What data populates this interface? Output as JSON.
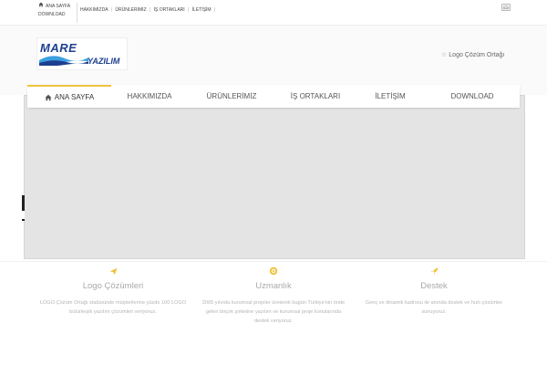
{
  "topbar": {
    "left_links": [
      "ANA SAYFA",
      "DOWNLOAD"
    ],
    "menu": [
      "HAKKIMIZDA",
      "ÜRÜNLERIMIZ",
      "İŞ ORTAKLARI",
      "İLETİŞİM"
    ],
    "menu_sep": "|"
  },
  "header": {
    "logo_top": "MARE",
    "logo_bottom": "YAZILIM",
    "partner_text": "Logo Çözüm Ortağı"
  },
  "nav": {
    "items": [
      "ANA SAYFA",
      "HAKKIMIZDA",
      "ÜRÜNLERİMİZ",
      "İŞ ORTAKLARI",
      "İLETİŞİM",
      "DOWNLOAD"
    ]
  },
  "features": [
    {
      "icon": "send-icon",
      "title": "Logo Çözümleri",
      "text": "LOGO Çözüm Ortağı statüsünde müşterilerine yüzde 100 LOGO bütünleşik yazılım çözümleri veriyoruz."
    },
    {
      "icon": "badge-icon",
      "title": "Uzmanlık",
      "text": "2005 yılında kurumsal projeler üreterek bugün Türkiye'nin önde gelen birçok şirketine yazılım ve kurumsal proje konularında destek veriyoruz."
    },
    {
      "icon": "rocket-icon",
      "title": "Destek",
      "text": "Genç ve dinamik kadrosu ile anında destek ve hızlı çözümler sunuyoruz."
    }
  ],
  "colors": {
    "accent": "#f0c33c",
    "logo_blue": "#1d3f8f",
    "slider_bg": "#e4e4e4"
  }
}
